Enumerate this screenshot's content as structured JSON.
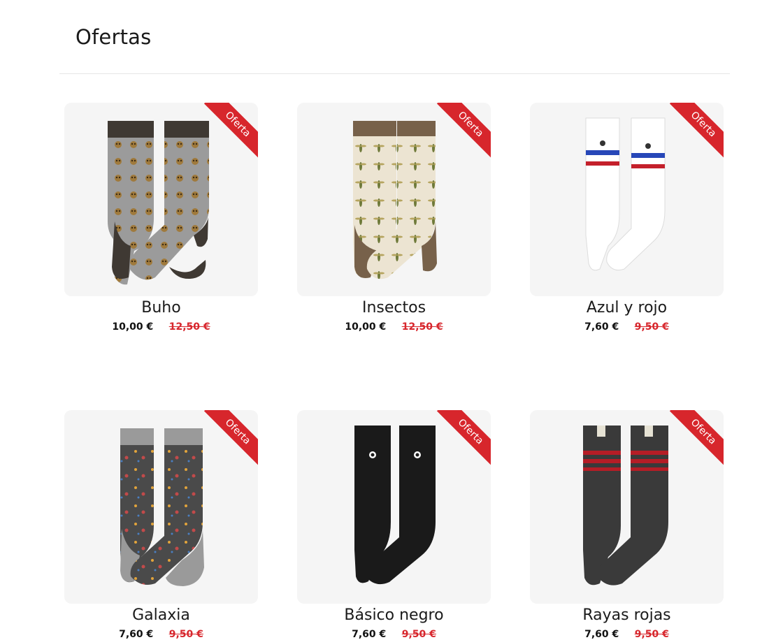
{
  "page": {
    "title": "Ofertas"
  },
  "badge_label": "Oferta",
  "colors": {
    "accent": "#d7262c",
    "card_bg": "#f5f5f5"
  },
  "products": [
    {
      "name": "Buho",
      "price": "10,00 €",
      "old_price": "12,50 €",
      "image_icon": "owl-sock-icon"
    },
    {
      "name": "Insectos",
      "price": "10,00 €",
      "old_price": "12,50 €",
      "image_icon": "insect-sock-icon"
    },
    {
      "name": "Azul y rojo",
      "price": "7,60 €",
      "old_price": "9,50 €",
      "image_icon": "striped-white-sock-icon"
    },
    {
      "name": "Galaxia",
      "price": "7,60 €",
      "old_price": "9,50 €",
      "image_icon": "galaxy-sock-icon"
    },
    {
      "name": "Básico negro",
      "price": "7,60 €",
      "old_price": "9,50 €",
      "image_icon": "black-sock-icon"
    },
    {
      "name": "Rayas rojas",
      "price": "7,60 €",
      "old_price": "9,50 €",
      "image_icon": "red-stripe-sock-icon"
    }
  ]
}
